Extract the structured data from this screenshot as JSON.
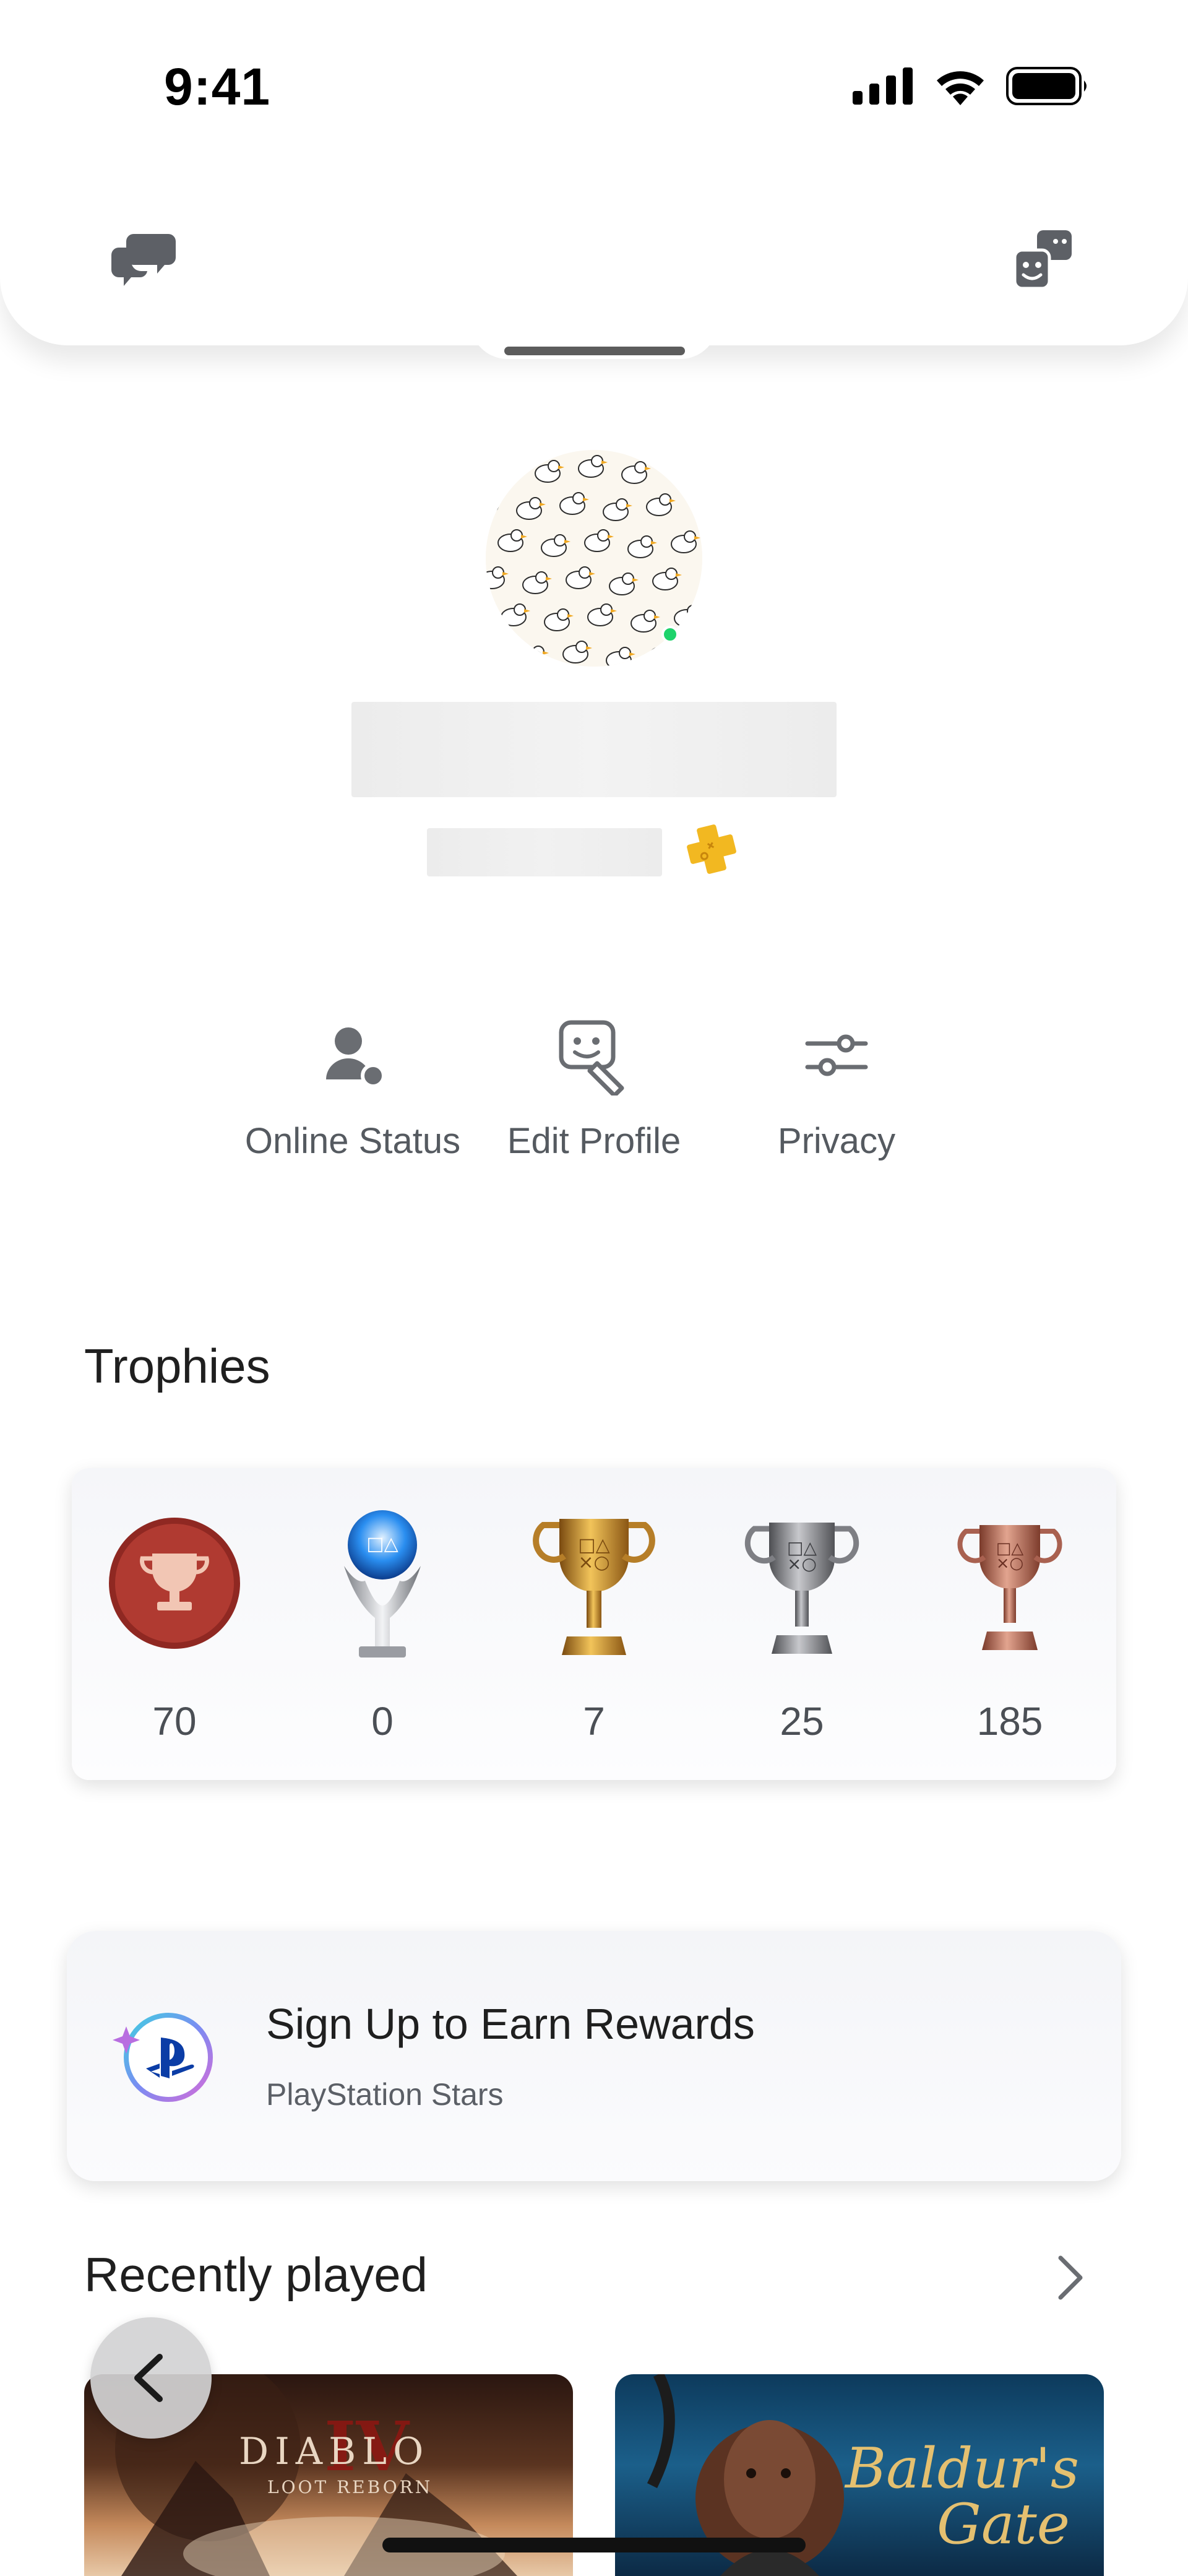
{
  "status_bar": {
    "time": "9:41"
  },
  "profile": {
    "online": true
  },
  "actions": [
    {
      "label": "Online Status",
      "icon": "person-status-icon"
    },
    {
      "label": "Edit Profile",
      "icon": "edit-profile-icon"
    },
    {
      "label": "Privacy",
      "icon": "sliders-icon"
    }
  ],
  "trophies": {
    "title": "Trophies",
    "items": [
      {
        "kind": "level",
        "count": "70"
      },
      {
        "kind": "platinum",
        "count": "0"
      },
      {
        "kind": "gold",
        "count": "7"
      },
      {
        "kind": "silver",
        "count": "25"
      },
      {
        "kind": "bronze",
        "count": "185"
      }
    ]
  },
  "rewards": {
    "title": "Sign Up to Earn Rewards",
    "subtitle": "PlayStation Stars"
  },
  "recently_played": {
    "title": "Recently played",
    "games": [
      {
        "title": "DIABLO",
        "subtitle": "LOOT REBORN",
        "numeral": "IV"
      },
      {
        "title": "Baldur's",
        "subtitle": "Gate"
      }
    ]
  },
  "colors": {
    "online": "#1ed36b",
    "plus_gold": "#f2b821",
    "level_red": "#a8322b",
    "gold": "#c8902a",
    "silver": "#8d8d90",
    "bronze": "#b66b58",
    "platinum_blue": "#2a8ef0"
  }
}
